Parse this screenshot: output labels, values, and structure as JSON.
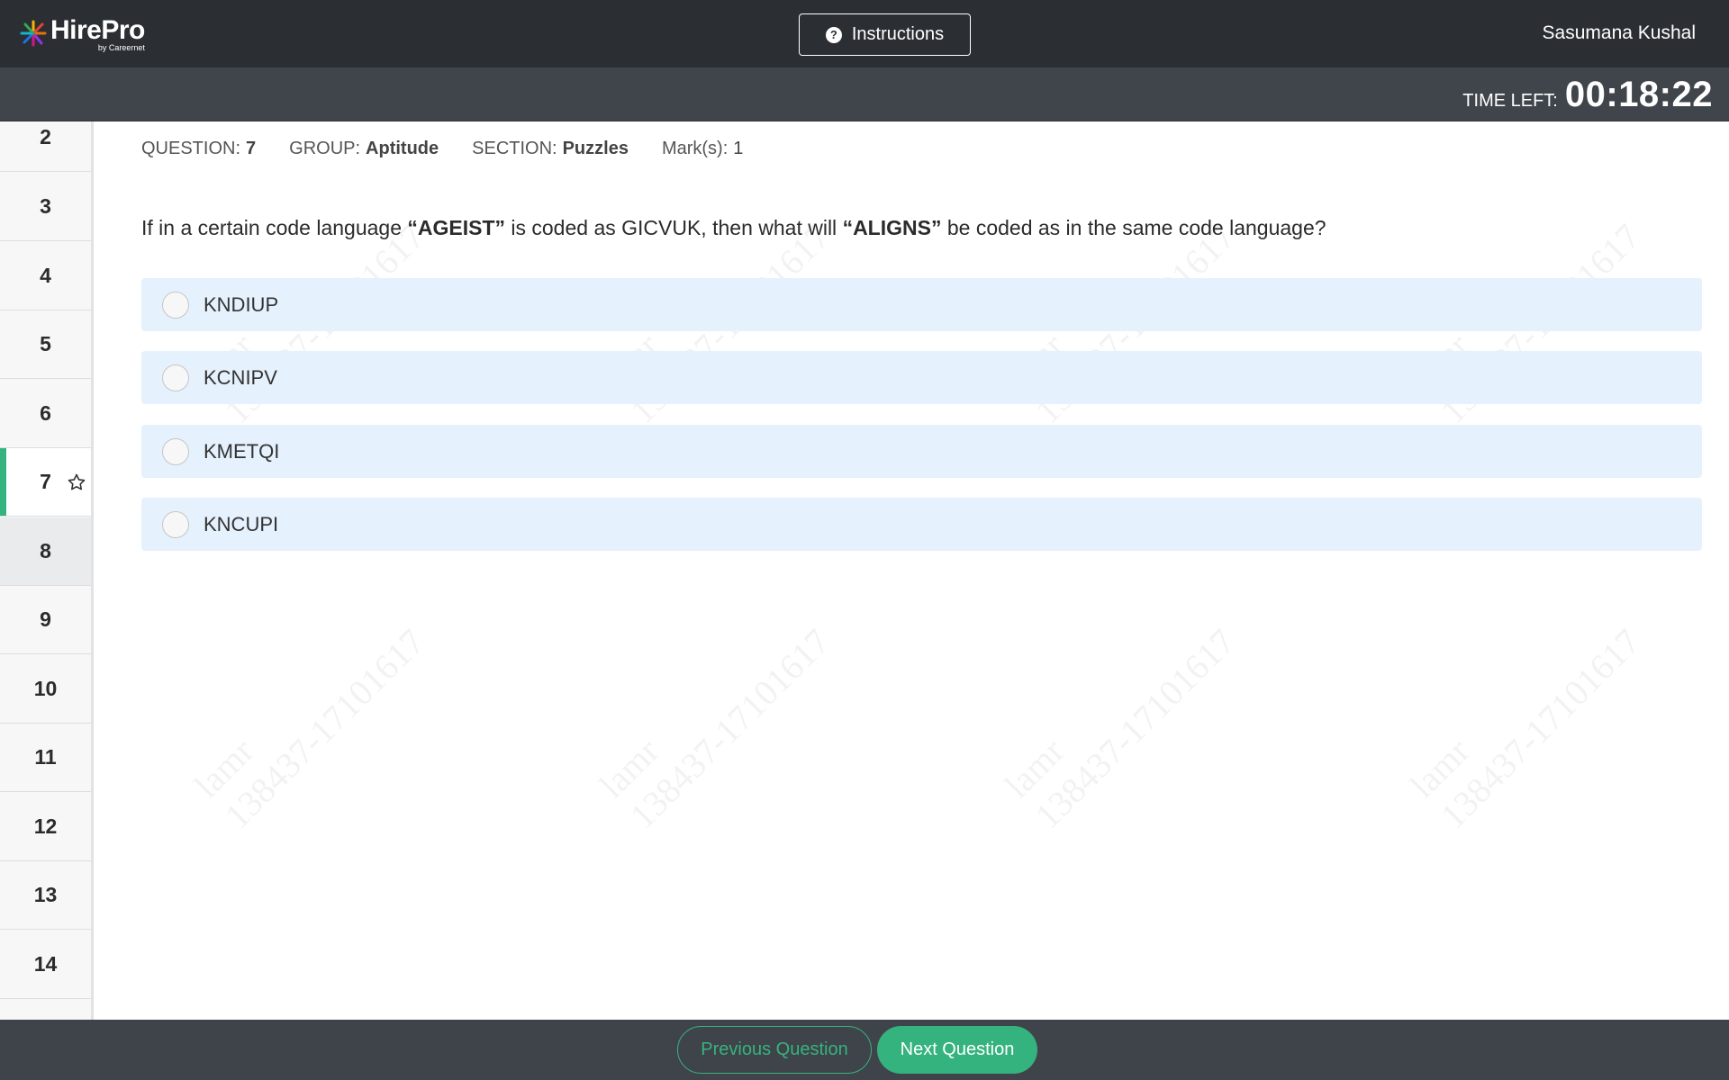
{
  "header": {
    "logo_name": "HirePro",
    "logo_sub": "by Careernet",
    "instructions_label": "Instructions",
    "user_name": "Sasumana Kushal"
  },
  "timer": {
    "label": "TIME LEFT:",
    "value": "00:18:22"
  },
  "sidebar": {
    "items": [
      {
        "number": "2"
      },
      {
        "number": "3"
      },
      {
        "number": "4"
      },
      {
        "number": "5"
      },
      {
        "number": "6"
      },
      {
        "number": "7",
        "state": "active",
        "bookmark_icon": "star-outline-icon"
      },
      {
        "number": "8",
        "state": "hover"
      },
      {
        "number": "9"
      },
      {
        "number": "10"
      },
      {
        "number": "11"
      },
      {
        "number": "12"
      },
      {
        "number": "13"
      },
      {
        "number": "14"
      }
    ]
  },
  "meta": {
    "question_label": "QUESTION:",
    "question_value": "7",
    "group_label": "GROUP:",
    "group_value": "Aptitude",
    "section_label": "SECTION:",
    "section_value": "Puzzles",
    "marks_label": "Mark(s):",
    "marks_value": "1"
  },
  "question": {
    "part1": "If in a certain code language ",
    "word1": "“AGEIST”",
    "part2": " is coded as GICVUK, then what will ",
    "word2": "“ALIGNS”",
    "part3": " be coded as in the same code language?"
  },
  "options": [
    {
      "label": "KNDIUP"
    },
    {
      "label": "KCNIPV"
    },
    {
      "label": "KMETQI"
    },
    {
      "label": "KNCUPI"
    }
  ],
  "watermark": {
    "line1": "lamr",
    "line2": "138437-17101617"
  },
  "footer": {
    "prev_label": "Previous Question",
    "next_label": "Next Question"
  },
  "colors": {
    "topbar": "#2b2f33",
    "timerbar": "#40454b",
    "accent": "#35b37e",
    "option_bg": "#e5f1fd"
  }
}
